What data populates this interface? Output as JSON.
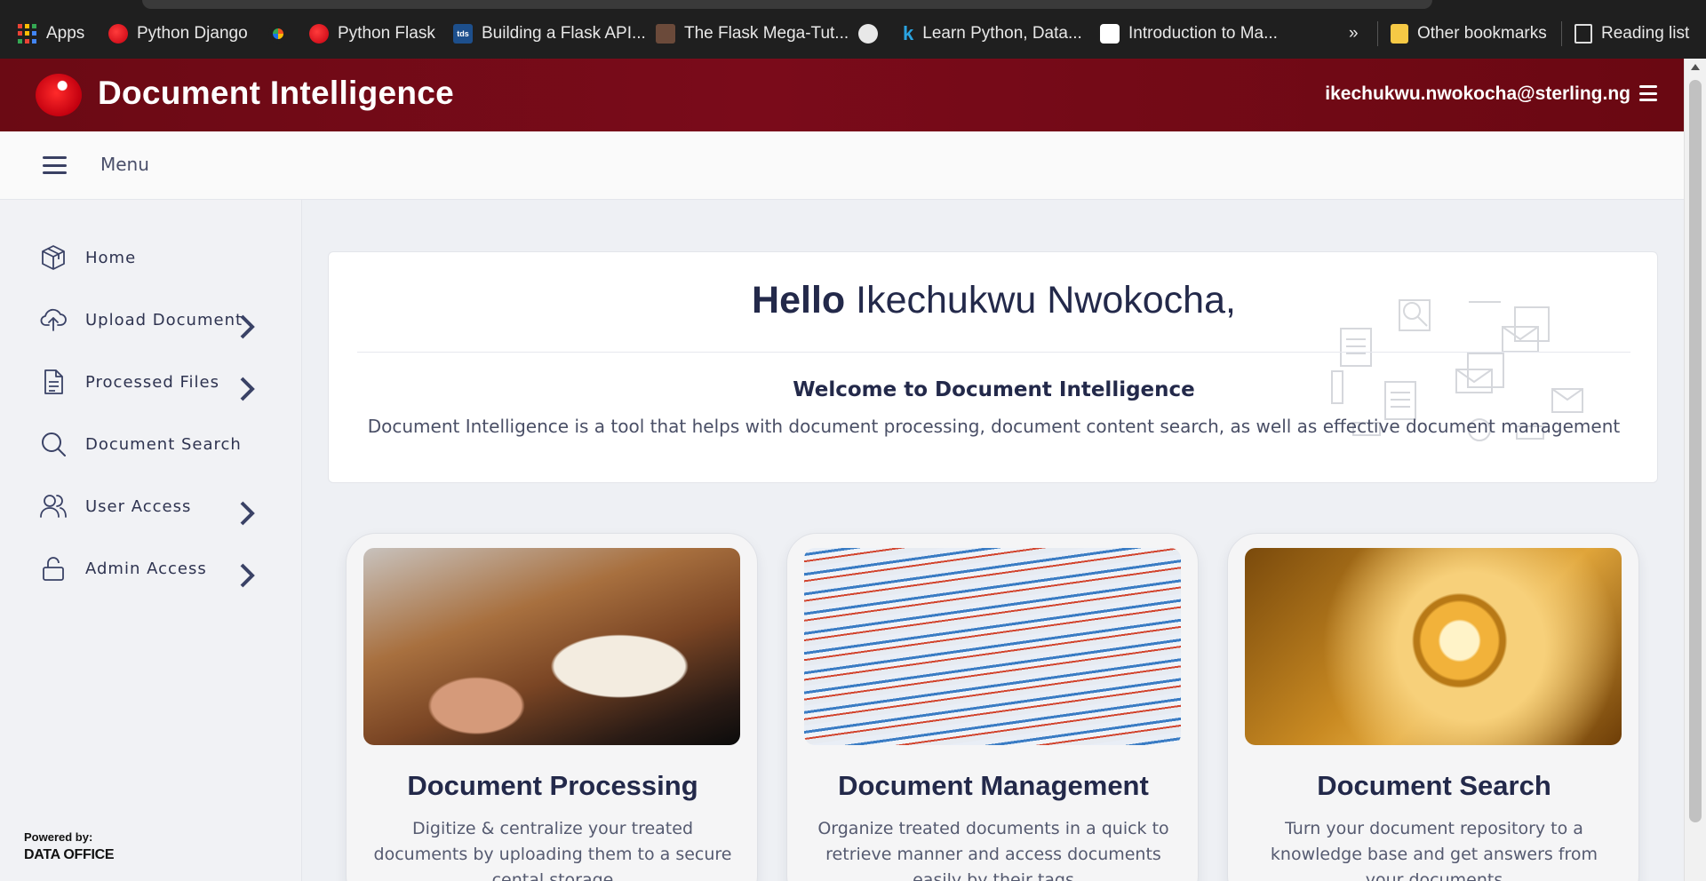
{
  "bookmarks": {
    "items": [
      {
        "label": "Apps",
        "icon": "apps-grid-icon"
      },
      {
        "label": "Python Django",
        "icon": "red-ball-icon"
      },
      {
        "label": "",
        "icon": "c-logo-icon"
      },
      {
        "label": "Python Flask",
        "icon": "red-ball-icon"
      },
      {
        "label": "Building a Flask API...",
        "icon": "tds-icon"
      },
      {
        "label": "The Flask Mega-Tut...",
        "icon": "profile-photo-icon"
      },
      {
        "label": "",
        "icon": "globe-icon"
      },
      {
        "label": "Learn Python, Data...",
        "icon": "k-logo-icon"
      },
      {
        "label": "Introduction to Ma...",
        "icon": "google-cloud-icon"
      }
    ],
    "overflow": "»",
    "other": "Other bookmarks",
    "reading_list": "Reading list"
  },
  "header": {
    "title": "Document Intelligence",
    "user_email": "ikechukwu.nwokocha@sterling.ng",
    "brand_color": "#6b0a14"
  },
  "menu_bar": {
    "label": "Menu"
  },
  "sidebar": {
    "items": [
      {
        "label": "Home",
        "icon": "cube-icon",
        "has_chevron": false
      },
      {
        "label": "Upload Document",
        "icon": "cloud-upload-icon",
        "has_chevron": true
      },
      {
        "label": "Processed Files",
        "icon": "file-text-icon",
        "has_chevron": true
      },
      {
        "label": "Document Search",
        "icon": "search-icon",
        "has_chevron": false
      },
      {
        "label": "User Access",
        "icon": "users-icon",
        "has_chevron": true
      },
      {
        "label": "Admin Access",
        "icon": "unlock-icon",
        "has_chevron": true
      }
    ],
    "powered_by_label": "Powered by:",
    "powered_by_org": "DATA OFFICE"
  },
  "welcome": {
    "greeting": "Hello",
    "name": "Ikechukwu Nwokocha,",
    "title": "Welcome to Document Intelligence",
    "description": "Document Intelligence is a tool that helps with document processing, document content search, as well as effective document management"
  },
  "features": [
    {
      "title": "Document Processing",
      "description": "Digitize & centralize your treated documents by uploading them to a secure cental storage",
      "image": "laptop-notebook-photo"
    },
    {
      "title": "Document Management",
      "description": "Organize treated documents in a quick to retrieve manner and access documents easily by their tags",
      "image": "paper-stack-photo"
    },
    {
      "title": "Document Search",
      "description": "Turn your document repository to a knowledge base and get answers from your documents",
      "image": "magnifying-glass-photo"
    }
  ]
}
